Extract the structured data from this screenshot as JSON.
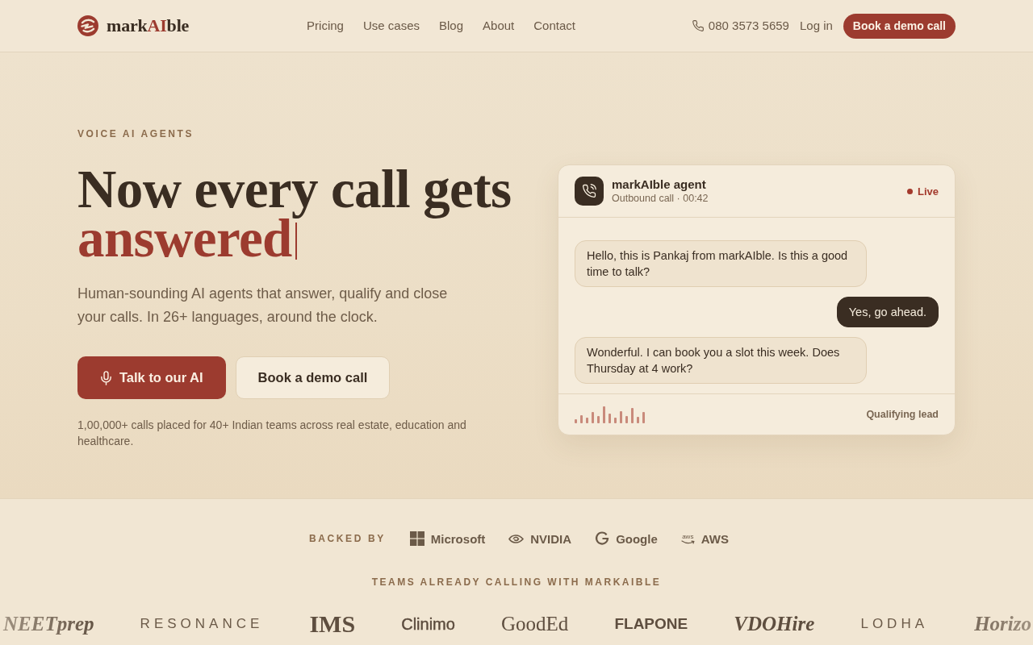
{
  "nav": {
    "logo": {
      "parts": [
        {
          "text": "mark",
          "accent": false
        },
        {
          "text": "AI",
          "accent": true
        },
        {
          "text": "ble",
          "accent": false
        }
      ]
    },
    "links": [
      "Pricing",
      "Use cases",
      "Blog",
      "About",
      "Contact"
    ],
    "phone": "080 3573 5659",
    "login": "Log in",
    "cta": "Book a demo call"
  },
  "hero": {
    "eyebrow": "VOICE AI AGENTS",
    "headline": "Now every call gets",
    "headline_accent": "answered",
    "typing_cursor": true,
    "subtitle": "Human-sounding AI agents that answer, qualify and close your calls. In 26+ languages, around the clock.",
    "buttons": [
      {
        "label": "Talk to our AI",
        "kind": "primary"
      },
      {
        "label": "Book a demo call",
        "kind": "secondary"
      }
    ],
    "proof": "1,00,000+ calls placed for 40+ Indian teams across real estate, education and healthcare."
  },
  "call_card": {
    "agent_name": "markAIble agent",
    "call_info": "Outbound call · 00:42",
    "status": "Live",
    "messages": [
      {
        "kind": "agent",
        "text": "Hello, this is Pankaj from markAIble. Is this a good time to talk?"
      },
      {
        "kind": "caller",
        "text": "Yes, go ahead."
      },
      {
        "kind": "agent",
        "text": "Wonderful. I can book you a slot this week. Does Thursday at 4 work?"
      }
    ],
    "footer_status": "Qualifying lead"
  },
  "backers": {
    "label": "BACKED BY",
    "items": [
      {
        "name": "Microsoft",
        "kind": "squares"
      },
      {
        "name": "NVIDIA",
        "kind": "eye"
      },
      {
        "name": "Google",
        "kind": "g"
      },
      {
        "name": "AWS",
        "kind": "smile",
        "mark_text": "aws"
      }
    ]
  },
  "customers": {
    "label": "TEAMS ALREADY CALLING WITH MARKAIBLE",
    "logos": [
      {
        "name": "NEETprep",
        "kind": "serif-italic"
      },
      {
        "name": "RESONANCE",
        "kind": "spaced"
      },
      {
        "name": "IMS",
        "kind": "serif-bold"
      },
      {
        "name": "Clinimo",
        "kind": "sans"
      },
      {
        "name": "GoodEd",
        "kind": "serif"
      },
      {
        "name": "FLAPONE",
        "kind": "sans-bold"
      },
      {
        "name": "VDOHire",
        "kind": "serif-italic"
      },
      {
        "name": "LODHA",
        "kind": "spaced"
      },
      {
        "name": "Horizo",
        "kind": "serif-italic"
      }
    ]
  }
}
